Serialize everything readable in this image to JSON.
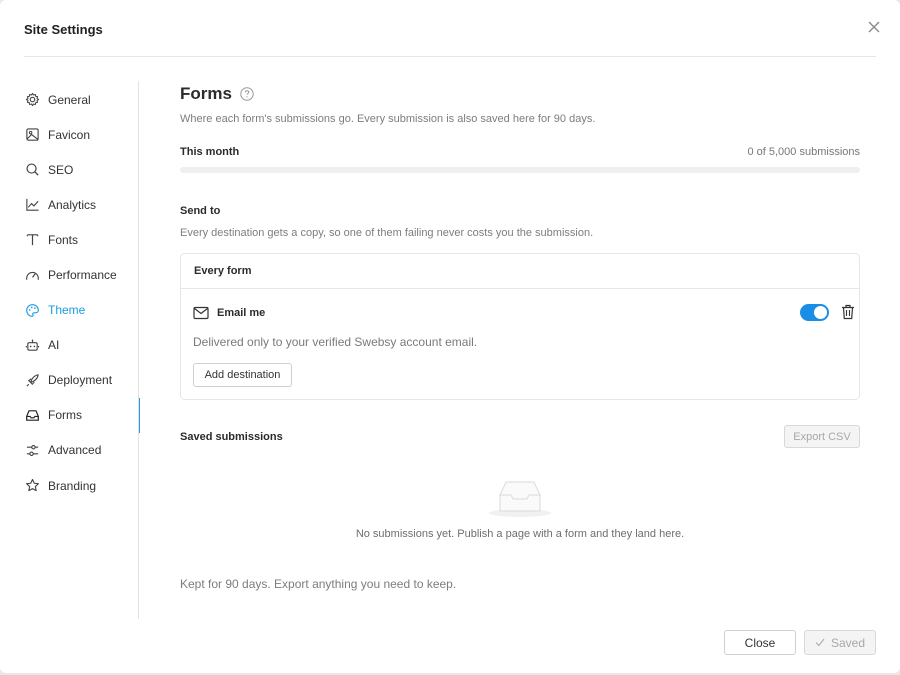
{
  "dialog": {
    "title": "Site Settings"
  },
  "sidebar": {
    "items": [
      {
        "label": "General",
        "icon": "gear-icon"
      },
      {
        "label": "Favicon",
        "icon": "image-icon"
      },
      {
        "label": "SEO",
        "icon": "search-icon"
      },
      {
        "label": "Analytics",
        "icon": "line-chart-icon"
      },
      {
        "label": "Fonts",
        "icon": "type-icon"
      },
      {
        "label": "Performance",
        "icon": "gauge-icon"
      },
      {
        "label": "Theme",
        "icon": "palette-icon"
      },
      {
        "label": "AI",
        "icon": "bot-icon"
      },
      {
        "label": "Deployment",
        "icon": "rocket-icon"
      },
      {
        "label": "Forms",
        "icon": "inbox-icon",
        "active": true
      },
      {
        "label": "Advanced",
        "icon": "sliders-icon"
      },
      {
        "label": "Branding",
        "icon": "star-icon"
      }
    ]
  },
  "forms": {
    "title": "Forms",
    "description": "Where each form's submissions go. Every submission is also saved here for 90 days.",
    "usage": {
      "label": "This month",
      "count_text": "0 of 5,000 submissions",
      "fraction": 0
    },
    "send_to": {
      "label": "Send to",
      "description": "Every destination gets a copy, so one of them failing never costs you the submission.",
      "card_title": "Every form",
      "destination": {
        "name": "Email me",
        "enabled": true,
        "description": "Delivered only to your verified Swebsy account email."
      },
      "add_button": "Add destination"
    },
    "saved": {
      "label": "Saved submissions",
      "export_button": "Export CSV",
      "empty_text": "No submissions yet. Publish a page with a form and they land here."
    },
    "retention_note": "Kept for 90 days. Export anything you need to keep."
  },
  "footer": {
    "close_button": "Close",
    "saved_button": "Saved"
  },
  "colors": {
    "accent": "#1a9de0",
    "toggle": "#1a8ee6"
  }
}
